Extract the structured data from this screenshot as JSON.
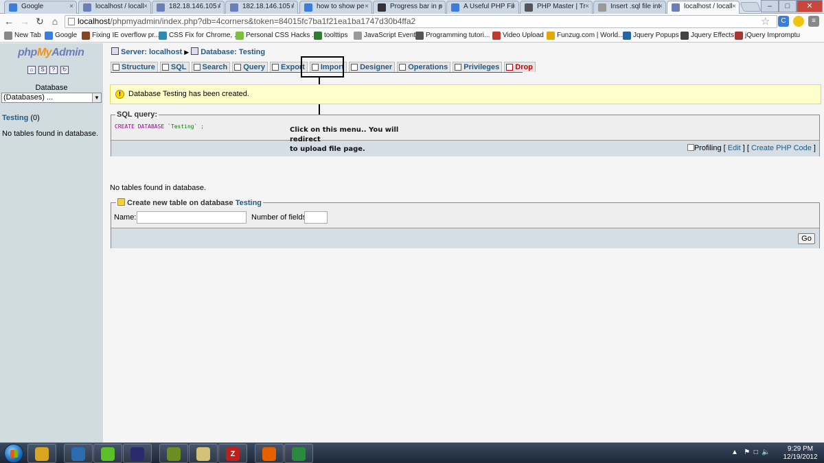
{
  "browser": {
    "tabs": [
      {
        "title": "Google",
        "favicon": "google-icon",
        "color": "#3b7ddd"
      },
      {
        "title": "localhost / locall",
        "favicon": "pma-icon",
        "color": "#6c7eb7"
      },
      {
        "title": "182.18.146.105 /",
        "favicon": "pma-icon",
        "color": "#6c7eb7"
      },
      {
        "title": "182.18.146.105 /",
        "favicon": "pma-icon",
        "color": "#6c7eb7"
      },
      {
        "title": "how to show pe",
        "favicon": "google-icon",
        "color": "#3b7ddd"
      },
      {
        "title": "Progress bar in p",
        "favicon": "diamond-icon",
        "color": "#333333"
      },
      {
        "title": "A Useful PHP Fil",
        "favicon": "google-icon",
        "color": "#3b7ddd"
      },
      {
        "title": "PHP Master | Tr",
        "favicon": "php-icon",
        "color": "#555555"
      },
      {
        "title": "Insert .sql file int",
        "favicon": "page-icon",
        "color": "#999999"
      },
      {
        "title": "localhost / locall",
        "favicon": "pma-icon",
        "color": "#6c7eb7"
      }
    ],
    "active_tab": 9,
    "tab_close_glyph": "×",
    "window_controls": {
      "minimize": "–",
      "maximize": "□",
      "close": "✕"
    },
    "url_host": "localhost",
    "url_rest": "/phpmyadmin/index.php?db=4corners&token=84015fc7ba1f21ea1ba1747d30b4ffa2",
    "bookmarks": [
      {
        "label": "New Tab",
        "color": "#888888"
      },
      {
        "label": "Google",
        "color": "#3b7ddd"
      },
      {
        "label": "Fixing IE overflow pr...",
        "color": "#884422"
      },
      {
        "label": "CSS Fix for Chrome, ...",
        "color": "#2a8ab5"
      },
      {
        "label": "Personal CSS Hacks ...",
        "color": "#7bbf3a"
      },
      {
        "label": "toolttips",
        "color": "#2e7d32"
      },
      {
        "label": "JavaScript Events",
        "color": "#999999"
      },
      {
        "label": "Programming tutori...",
        "color": "#555555"
      },
      {
        "label": "Video Upload",
        "color": "#c0392b"
      },
      {
        "label": "Funzug.com | World...",
        "color": "#e6a700"
      },
      {
        "label": "Jquery Popups",
        "color": "#2266aa"
      },
      {
        "label": "Jquery Effects",
        "color": "#444444"
      },
      {
        "label": "jQuery Impromptu",
        "color": "#aa3333"
      }
    ]
  },
  "left_frame": {
    "logo": {
      "php": "php",
      "my": "My",
      "admin": "Admin"
    },
    "icons": [
      "home-icon",
      "sql-icon",
      "query-window-icon",
      "reload-icon"
    ],
    "database_label": "Database",
    "database_select": "(Databases) ...",
    "db_name": "Testing",
    "db_count": "(0)",
    "no_tables": "No tables found in database."
  },
  "main": {
    "server_label": "Server: localhost",
    "database_label": "Database: Testing",
    "tabs": [
      {
        "label": "Structure",
        "icon": "structure-icon"
      },
      {
        "label": "SQL",
        "icon": "sql-icon"
      },
      {
        "label": "Search",
        "icon": "search-icon"
      },
      {
        "label": "Query",
        "icon": "query-icon"
      },
      {
        "label": "Export",
        "icon": "export-icon"
      },
      {
        "label": "Import",
        "icon": "import-icon"
      },
      {
        "label": "Designer",
        "icon": "designer-icon"
      },
      {
        "label": "Operations",
        "icon": "operations-icon"
      },
      {
        "label": "Privileges",
        "icon": "privileges-icon"
      },
      {
        "label": "Drop",
        "icon": "drop-icon"
      }
    ],
    "notice": "Database Testing has been created.",
    "sql_legend": "SQL query:",
    "sql_keyword": "CREATE DATABASE",
    "sql_string": "`Testing`",
    "sql_end": ";",
    "profiling_label": "Profiling",
    "edit_link": "Edit",
    "create_php_link": "Create PHP Code",
    "annotation_line1": "Click on this menu.. You will redirect",
    "annotation_line2": "to upload file page.",
    "no_tables": "No tables found in database.",
    "create_legend_prefix": "Create new table on database",
    "create_legend_db": "Testing",
    "name_label": "Name:",
    "name_value": "",
    "fields_label": "Number of fields:",
    "fields_value": "",
    "go_label": "Go"
  },
  "taskbar": {
    "apps": [
      {
        "name": "explorer-icon",
        "color": "#d9a520",
        "glyph": ""
      },
      {
        "name": "thunderbird-icon",
        "color": "#2b6cb0",
        "glyph": ""
      },
      {
        "name": "frog-icon",
        "color": "#5cbf2a",
        "glyph": ""
      },
      {
        "name": "eclipse-icon",
        "color": "#2c2a6e",
        "glyph": ""
      },
      {
        "name": "calculator-icon",
        "color": "#6b8e23",
        "glyph": ""
      },
      {
        "name": "notepad-icon",
        "color": "#d4c27a",
        "glyph": ""
      },
      {
        "name": "filezilla-icon",
        "color": "#c0201c",
        "glyph": "Z"
      },
      {
        "name": "firefox-icon",
        "color": "#e66000",
        "glyph": ""
      },
      {
        "name": "chrome-icon",
        "color": "#2b8a3e",
        "glyph": ""
      }
    ],
    "time": "9:29 PM",
    "date": "12/19/2012"
  }
}
